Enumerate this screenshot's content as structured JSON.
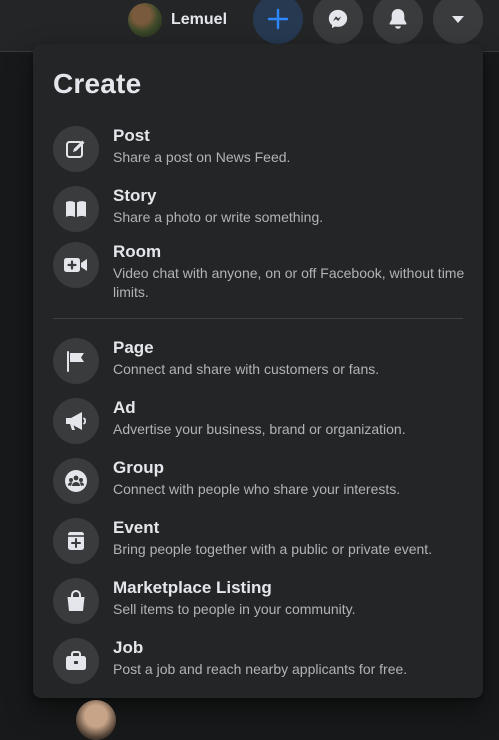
{
  "header": {
    "user_name": "Lemuel",
    "buttons": [
      {
        "name": "create",
        "icon": "plus-icon",
        "active": true
      },
      {
        "name": "messenger",
        "icon": "messenger-icon"
      },
      {
        "name": "notifications",
        "icon": "bell-icon"
      },
      {
        "name": "account",
        "icon": "caret-down-icon"
      }
    ]
  },
  "create_menu": {
    "title": "Create",
    "items": [
      {
        "title": "Post",
        "description": "Share a post on News Feed.",
        "icon": "compose-icon"
      },
      {
        "title": "Story",
        "description": "Share a photo or write something.",
        "icon": "book-icon"
      },
      {
        "title": "Room",
        "description": "Video chat with anyone, on or off Facebook, without time limits.",
        "icon": "video-plus-icon"
      },
      {
        "title": "Page",
        "description": "Connect and share with customers or fans.",
        "icon": "flag-icon"
      },
      {
        "title": "Ad",
        "description": "Advertise your business, brand or organization.",
        "icon": "megaphone-icon"
      },
      {
        "title": "Group",
        "description": "Connect with people who share your interests.",
        "icon": "group-icon"
      },
      {
        "title": "Event",
        "description": "Bring people together with a public or private event.",
        "icon": "calendar-plus-icon"
      },
      {
        "title": "Marketplace Listing",
        "description": "Sell items to people in your community.",
        "icon": "shopping-bag-icon"
      },
      {
        "title": "Job",
        "description": "Post a job and reach nearby applicants for free.",
        "icon": "briefcase-icon"
      }
    ]
  },
  "colors": {
    "background": "#18191a",
    "surface": "#242526",
    "icon_bg": "#3a3b3c",
    "accent": "#2d88ff",
    "text_primary": "#e4e6eb",
    "text_secondary": "#b0b3b8"
  }
}
